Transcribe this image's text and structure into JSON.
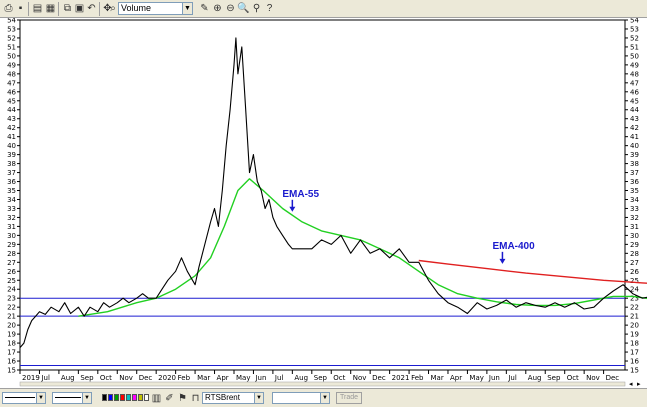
{
  "toolbar": {
    "indicator_value": "Volume",
    "icons": [
      "print-icon",
      "save-icon",
      "open-icon",
      "copy-icon",
      "paste-icon",
      "undo-icon",
      "zoom-in-icon",
      "zoom-out-icon",
      "pen-icon",
      "magnifier-icon",
      "crosshair-icon",
      "help-icon"
    ]
  },
  "bottom": {
    "symbol": "RTSBrent",
    "trade_label": "Trade",
    "colors": [
      "#000000",
      "#0000ff",
      "#00a000",
      "#ff0000",
      "#00c0c0",
      "#ff00ff",
      "#c0c000",
      "#ffffff"
    ]
  },
  "chart_data": {
    "type": "line",
    "ylim": [
      15,
      54
    ],
    "yticks": [
      15,
      16,
      17,
      18,
      19,
      20,
      21,
      22,
      23,
      24,
      25,
      26,
      27,
      28,
      29,
      30,
      31,
      32,
      33,
      34,
      35,
      36,
      37,
      38,
      39,
      40,
      41,
      42,
      43,
      44,
      45,
      46,
      47,
      48,
      49,
      50,
      51,
      52,
      53,
      54
    ],
    "x_months": [
      "2019",
      "Jul",
      "Aug",
      "Sep",
      "Oct",
      "Nov",
      "Dec",
      "2020",
      "Feb",
      "Mar",
      "Apr",
      "May",
      "Jun",
      "Jul",
      "Aug",
      "Sep",
      "Oct",
      "Nov",
      "Dec",
      "2021",
      "Feb",
      "Mar",
      "Apr",
      "May",
      "Jun",
      "Jul",
      "Aug",
      "Sep",
      "Oct",
      "Nov",
      "Dec"
    ],
    "horizontal_lines": [
      23.0,
      21.0,
      15.5
    ],
    "annotations": [
      {
        "text": "EMA-55",
        "x": 14.0,
        "y": 34.3
      },
      {
        "text": "EMA-400",
        "x": 24.8,
        "y": 28.5
      }
    ],
    "series": [
      {
        "color": "#000000",
        "values": [
          [
            0,
            17.5
          ],
          [
            0.2,
            18
          ],
          [
            0.4,
            19.5
          ],
          [
            0.6,
            20.5
          ],
          [
            0.8,
            21
          ],
          [
            1,
            21.5
          ],
          [
            1.3,
            21.2
          ],
          [
            1.6,
            22
          ],
          [
            2,
            21.5
          ],
          [
            2.3,
            22.5
          ],
          [
            2.6,
            21.3
          ],
          [
            3,
            22
          ],
          [
            3.3,
            21
          ],
          [
            3.6,
            22
          ],
          [
            4,
            21.5
          ],
          [
            4.3,
            22.5
          ],
          [
            4.6,
            22
          ],
          [
            5,
            22.5
          ],
          [
            5.3,
            23
          ],
          [
            5.6,
            22.5
          ],
          [
            6,
            23
          ],
          [
            6.3,
            23.5
          ],
          [
            6.6,
            23
          ],
          [
            7,
            23
          ],
          [
            7.3,
            24
          ],
          [
            7.6,
            25
          ],
          [
            8,
            26
          ],
          [
            8.3,
            27.5
          ],
          [
            8.6,
            26
          ],
          [
            9,
            24.5
          ],
          [
            9.2,
            26.5
          ],
          [
            9.5,
            29
          ],
          [
            9.8,
            31.5
          ],
          [
            10,
            33
          ],
          [
            10.2,
            31
          ],
          [
            10.4,
            35
          ],
          [
            10.6,
            40
          ],
          [
            10.8,
            44
          ],
          [
            11,
            49
          ],
          [
            11.1,
            52
          ],
          [
            11.2,
            48
          ],
          [
            11.4,
            51
          ],
          [
            11.6,
            44
          ],
          [
            11.8,
            37
          ],
          [
            12,
            39
          ],
          [
            12.2,
            36
          ],
          [
            12.4,
            35
          ],
          [
            12.6,
            33
          ],
          [
            12.8,
            34
          ],
          [
            13,
            32
          ],
          [
            13.2,
            31
          ],
          [
            13.5,
            30
          ],
          [
            13.8,
            29
          ],
          [
            14,
            28.5
          ],
          [
            14.5,
            28.5
          ],
          [
            15,
            28.5
          ],
          [
            15.5,
            29.5
          ],
          [
            16,
            29
          ],
          [
            16.5,
            30
          ],
          [
            17,
            28
          ],
          [
            17.5,
            29.5
          ],
          [
            18,
            28
          ],
          [
            18.5,
            28.5
          ],
          [
            19,
            27.5
          ],
          [
            19.5,
            28.5
          ],
          [
            20,
            27
          ],
          [
            20.5,
            27
          ],
          [
            21,
            25
          ],
          [
            21.5,
            23.5
          ],
          [
            22,
            22.5
          ],
          [
            22.5,
            22
          ],
          [
            23,
            21.3
          ],
          [
            23.5,
            22.5
          ],
          [
            24,
            21.8
          ],
          [
            24.5,
            22.2
          ],
          [
            25,
            22.8
          ],
          [
            25.5,
            22
          ],
          [
            26,
            22.5
          ],
          [
            26.5,
            22.2
          ],
          [
            27,
            22
          ],
          [
            27.5,
            22.5
          ],
          [
            28,
            22
          ],
          [
            28.5,
            22.5
          ],
          [
            29,
            21.8
          ],
          [
            29.5,
            22
          ],
          [
            30,
            23
          ],
          [
            30.5,
            23.8
          ],
          [
            31,
            24.5
          ],
          [
            31.5,
            23.5
          ],
          [
            32,
            23
          ],
          [
            32.5,
            23.2
          ],
          [
            33,
            22.5
          ],
          [
            33.5,
            22.2
          ],
          [
            34,
            22.5
          ],
          [
            34.3,
            23.5
          ],
          [
            34.6,
            22.5
          ],
          [
            35,
            22
          ],
          [
            35.3,
            21.8
          ],
          [
            35.6,
            22.2
          ],
          [
            36,
            22.5
          ],
          [
            36.3,
            21.8
          ],
          [
            36.6,
            21.2
          ],
          [
            37,
            21
          ],
          [
            37.2,
            23.5
          ],
          [
            37.4,
            24
          ],
          [
            37.6,
            23.5
          ],
          [
            37.8,
            22
          ]
        ]
      },
      {
        "color": "#22d022",
        "values": [
          [
            3,
            21.0
          ],
          [
            4.5,
            21.5
          ],
          [
            6,
            22.5
          ],
          [
            7,
            23
          ],
          [
            8,
            24
          ],
          [
            9,
            25.5
          ],
          [
            9.8,
            27.5
          ],
          [
            10.5,
            31
          ],
          [
            11.2,
            35
          ],
          [
            11.8,
            36.3
          ],
          [
            12.5,
            35
          ],
          [
            13.5,
            33
          ],
          [
            14.5,
            31.5
          ],
          [
            15.5,
            30.5
          ],
          [
            16.5,
            30
          ],
          [
            17.5,
            29.5
          ],
          [
            18.5,
            28.5
          ],
          [
            19.5,
            27.5
          ],
          [
            20.5,
            26
          ],
          [
            21.5,
            24.5
          ],
          [
            22.5,
            23.5
          ],
          [
            23.5,
            23
          ],
          [
            24.5,
            22.6
          ],
          [
            25.5,
            22.3
          ],
          [
            26.5,
            22.2
          ],
          [
            27.5,
            22.2
          ],
          [
            28.5,
            22.4
          ],
          [
            29.5,
            22.8
          ],
          [
            30.5,
            23.2
          ],
          [
            31.5,
            23.2
          ],
          [
            32.5,
            22.9
          ],
          [
            33.5,
            22.6
          ],
          [
            34.5,
            22.4
          ],
          [
            35.5,
            22.2
          ],
          [
            36.5,
            22.0
          ],
          [
            37.5,
            21.8
          ]
        ]
      },
      {
        "color": "#e02020",
        "values": [
          [
            20.5,
            27.2
          ],
          [
            22,
            26.8
          ],
          [
            24,
            26.3
          ],
          [
            26,
            25.8
          ],
          [
            28,
            25.4
          ],
          [
            30,
            25
          ],
          [
            32,
            24.7
          ],
          [
            34,
            24.4
          ],
          [
            36,
            24.2
          ],
          [
            37.5,
            24
          ]
        ]
      }
    ]
  }
}
